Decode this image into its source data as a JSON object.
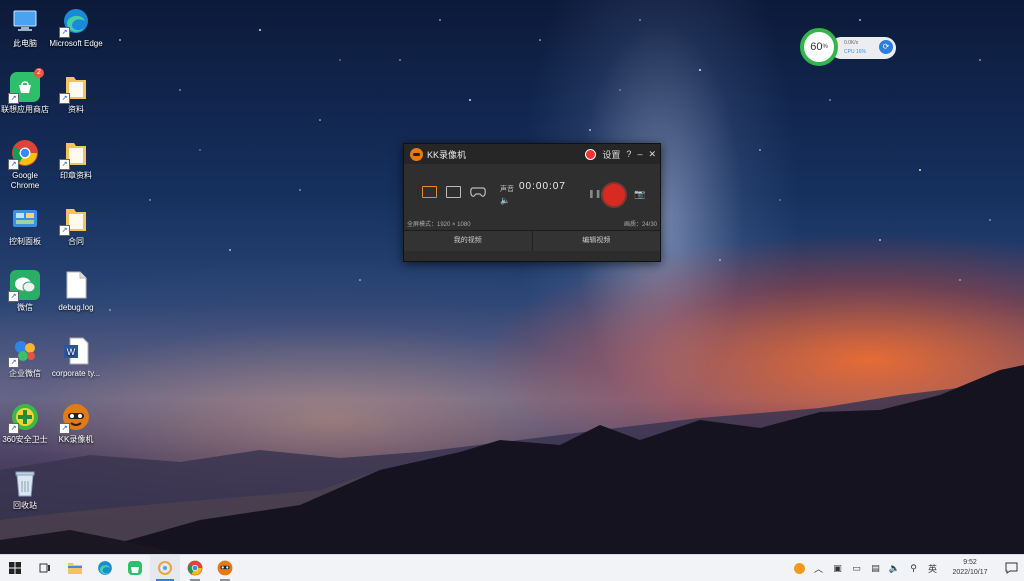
{
  "desktop_icons": [
    {
      "label": "此电脑",
      "icon": "computer-icon"
    },
    {
      "label": "Microsoft Edge",
      "icon": "edge-icon"
    },
    {
      "label": "联想应用商店",
      "icon": "lenovo-store-icon",
      "badge": "2"
    },
    {
      "label": "资料",
      "icon": "folder-icon"
    },
    {
      "label": "Google Chrome",
      "icon": "chrome-icon"
    },
    {
      "label": "印章资料",
      "icon": "folder-icon"
    },
    {
      "label": "控制面板",
      "icon": "control-panel-icon"
    },
    {
      "label": "合同",
      "icon": "folder-icon"
    },
    {
      "label": "微信",
      "icon": "wechat-icon"
    },
    {
      "label": "debug.log",
      "icon": "file-icon"
    },
    {
      "label": "企业微信",
      "icon": "wecom-icon"
    },
    {
      "label": "corporate ty...",
      "icon": "word-doc-icon"
    },
    {
      "label": "360安全卫士",
      "icon": "360-icon"
    },
    {
      "label": "KK录像机",
      "icon": "kk-recorder-icon"
    },
    {
      "label": "回收站",
      "icon": "recycle-bin-icon"
    }
  ],
  "recorder": {
    "title": "KK录像机",
    "settings_label": "设置",
    "help_label": "?",
    "minimize_label": "–",
    "close_label": "✕",
    "audio_label": "声音",
    "timer": "00:00:07",
    "status_left": "全屏模式：1920 × 1080",
    "status_right": "画质：24/30",
    "footer_left": "我的视频",
    "footer_right": "编辑视频"
  },
  "widget": {
    "percent": "60",
    "percent_unit": "%",
    "net_speed": "0.0K/s",
    "cpu_label": "CPU 16%"
  },
  "taskbar": {
    "apps": [
      "start-icon",
      "task-view-icon",
      "file-explorer-icon",
      "edge-icon",
      "lenovo-store-icon",
      "photos-icon",
      "chrome-icon",
      "kk-recorder-icon"
    ]
  },
  "tray": {
    "ime": "英",
    "time": "9:52",
    "date": "2022/10/17"
  },
  "colors": {
    "accent": "#3a7fd5",
    "record_red": "#d92a22",
    "kk_orange": "#e58b2a",
    "widget_green": "#34b54a"
  }
}
